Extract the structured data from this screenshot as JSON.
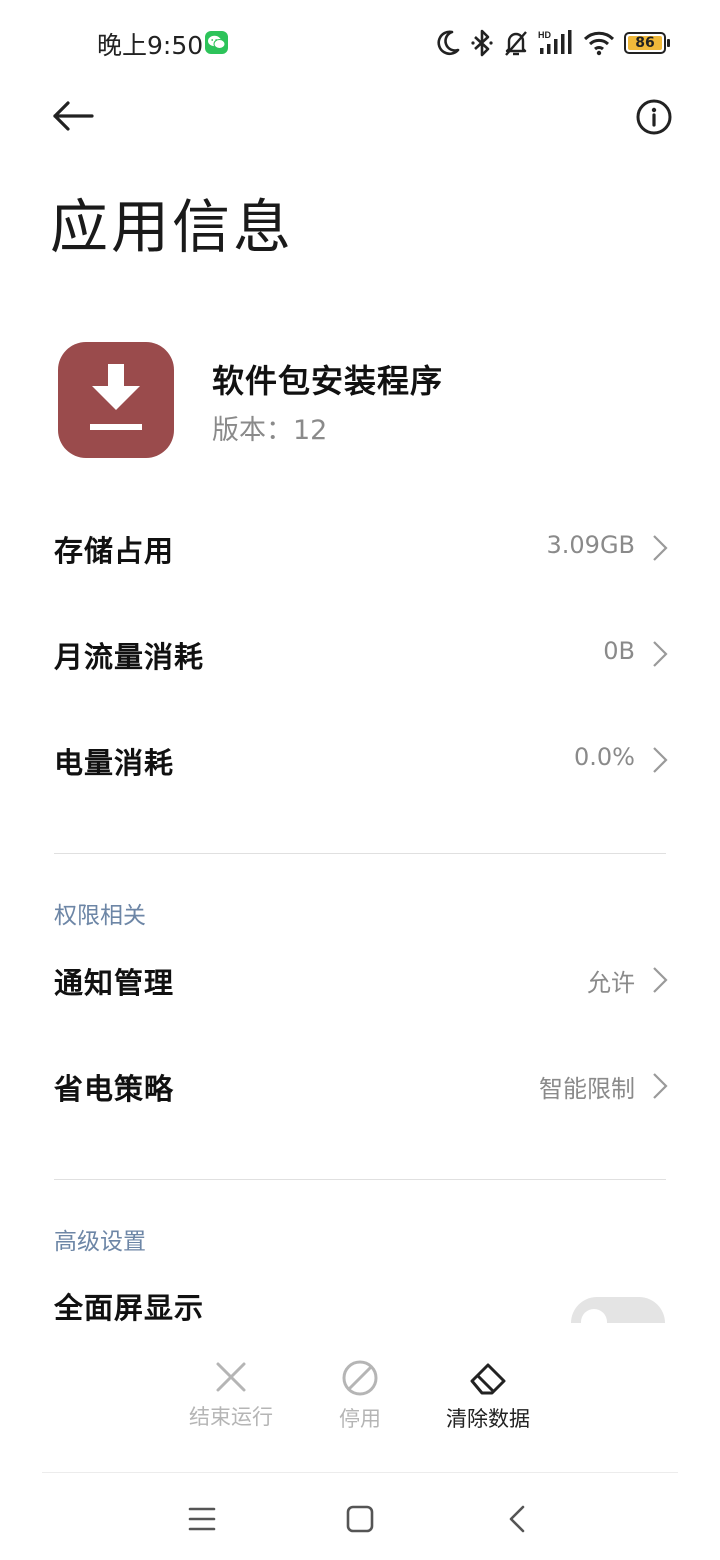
{
  "status_bar": {
    "time": "晚上9:50",
    "hd_label": "HD",
    "battery": "86",
    "icons": [
      "wechat-icon",
      "moon-icon",
      "bluetooth-icon",
      "bell-off-icon",
      "signal-icon",
      "wifi-icon",
      "battery-icon"
    ]
  },
  "header": {
    "title": "应用信息",
    "back_icon": "arrow-left-icon",
    "info_icon": "info-icon"
  },
  "app": {
    "name": "软件包安装程序",
    "version": "版本：12",
    "icon": "download-icon",
    "icon_color": "#9a4b4c"
  },
  "usage_rows": [
    {
      "label": "存储占用",
      "value": "3.09GB"
    },
    {
      "label": "月流量消耗",
      "value": "0B"
    },
    {
      "label": "电量消耗",
      "value": "0.0%"
    }
  ],
  "permissions": {
    "header": "权限相关",
    "rows": [
      {
        "label": "通知管理",
        "value": "允许"
      },
      {
        "label": "省电策略",
        "value": "智能限制"
      }
    ]
  },
  "advanced": {
    "header": "高级设置",
    "rows": [
      {
        "label": "全面屏显示"
      }
    ]
  },
  "actions": [
    {
      "label": "结束运行",
      "icon": "close-icon",
      "enabled": false
    },
    {
      "label": "停用",
      "icon": "disable-icon",
      "enabled": false
    },
    {
      "label": "清除数据",
      "icon": "eraser-icon",
      "enabled": true
    }
  ],
  "nav": {
    "icons": [
      "menu-icon",
      "home-icon",
      "back-chevron-icon"
    ]
  },
  "colors": {
    "section_header": "#6d86a6",
    "secondary_text": "#8a8a8a",
    "battery_fill": "#f0b93a",
    "wechat_green": "#2dc35a"
  }
}
